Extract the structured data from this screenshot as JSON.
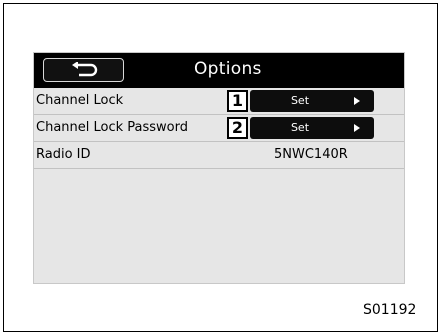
{
  "header": {
    "title": "Options",
    "back_icon": "u-turn-back-icon"
  },
  "rows": [
    {
      "label": "Channel Lock",
      "number": "1",
      "button_label": "Set",
      "arrow_icon": "triangle-right-icon"
    },
    {
      "label": "Channel Lock Password",
      "number": "2",
      "button_label": "Set",
      "arrow_icon": "triangle-right-icon"
    },
    {
      "label": "Radio ID",
      "value": "5NWC140R"
    }
  ],
  "figure_code": "S01192"
}
